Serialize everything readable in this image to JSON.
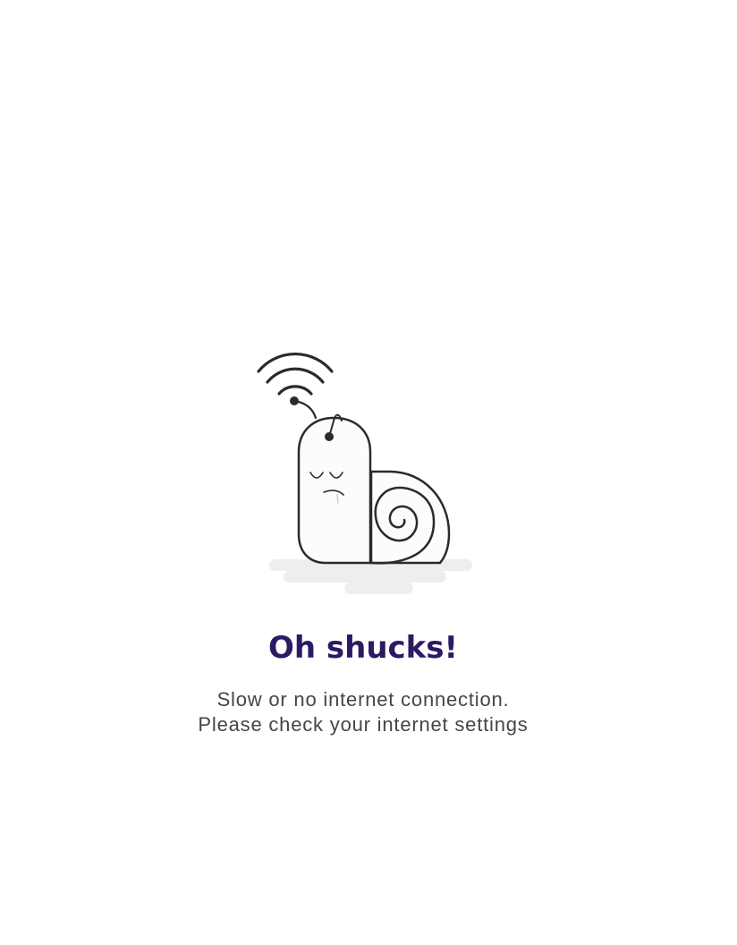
{
  "error_screen": {
    "title": "Oh shucks!",
    "message_line_1": "Slow or no internet connection.",
    "message_line_2": "Please check your internet settings",
    "illustration_icon": "sleepy-snail-wifi-icon"
  },
  "colors": {
    "background": "#ffffff",
    "title": "#2c1a66",
    "message": "#454545",
    "illustration_stroke": "#2b2b2b",
    "illustration_fill": "#fcfcfc",
    "shadow": "#eeeeee"
  }
}
